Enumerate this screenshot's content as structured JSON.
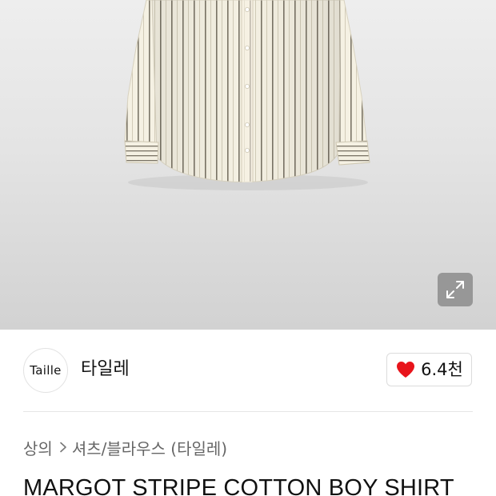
{
  "product": {
    "title": "MARGOT STRIPE COTTON BOY SHIRT",
    "image_alt": "stripe cotton shirt"
  },
  "seller": {
    "logo_text": "Taille",
    "name": "타일레"
  },
  "likes": {
    "count": "6.4천",
    "icon": "heart-icon",
    "color": "#e8141b"
  },
  "breadcrumb": {
    "items": [
      "상의",
      "셔츠/블라우스 (타일레)"
    ],
    "separator_icon": "chevron-right-icon"
  },
  "zoom": {
    "icon": "expand-icon"
  }
}
